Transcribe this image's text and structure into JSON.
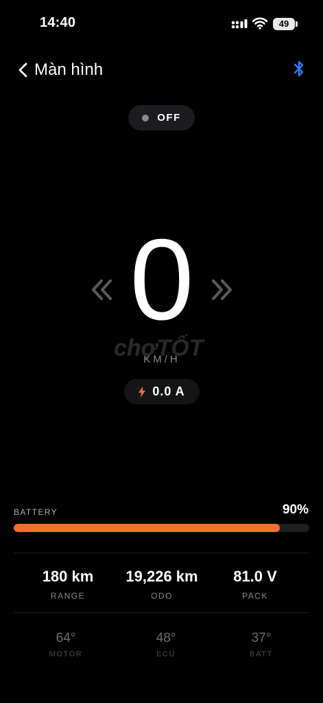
{
  "status_bar": {
    "time": "14:40",
    "battery_level": "49"
  },
  "header": {
    "title": "Màn hình"
  },
  "power": {
    "state": "OFF"
  },
  "speed": {
    "value": "0",
    "unit": "KM/H"
  },
  "current": {
    "value": "0.0 A"
  },
  "watermark": {
    "text": "chợTỐT"
  },
  "battery": {
    "label": "BATTERY",
    "percent_text": "90%",
    "percent": 0.9,
    "fill_color": "#f07030"
  },
  "stats": [
    {
      "value": "180 km",
      "label": "RANGE"
    },
    {
      "value": "19,226 km",
      "label": "ODO"
    },
    {
      "value": "81.0 V",
      "label": "PACK"
    }
  ],
  "temps": [
    {
      "value": "64°",
      "label": "MOTOR"
    },
    {
      "value": "48°",
      "label": "ECU"
    },
    {
      "value": "37°",
      "label": "BATT"
    }
  ],
  "colors": {
    "accent": "#f07030",
    "bluetooth": "#2f7cf6"
  },
  "icons": [
    "signal-icon",
    "wifi-icon",
    "battery-icon",
    "back-chevron-icon",
    "bluetooth-icon",
    "double-chevron-left-icon",
    "double-chevron-right-icon",
    "bolt-icon"
  ]
}
